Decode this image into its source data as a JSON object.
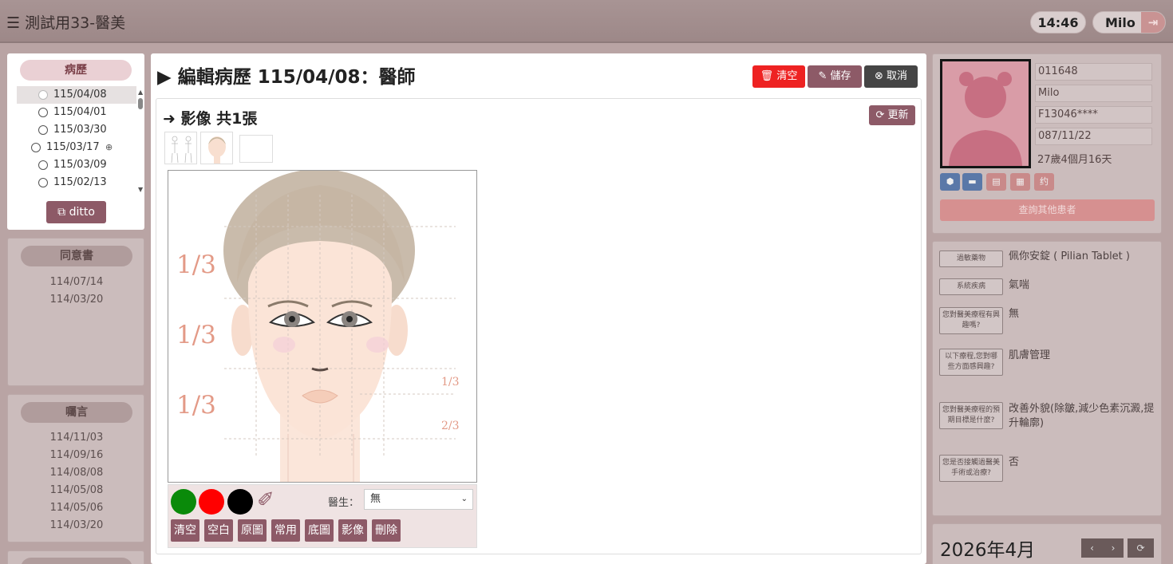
{
  "header": {
    "title": "測試用33-醫美",
    "time": "14:46",
    "user": "Milo"
  },
  "history": {
    "title": "病歷",
    "items": [
      {
        "date": "115/04/08",
        "selected": true
      },
      {
        "date": "115/04/01"
      },
      {
        "date": "115/03/30"
      },
      {
        "date": "115/03/17"
      },
      {
        "date": "115/03/09"
      },
      {
        "date": "115/02/13"
      }
    ],
    "ditto_label": "ditto"
  },
  "consent": {
    "title": "同意書",
    "dates": [
      "114/07/14",
      "114/03/20"
    ]
  },
  "instructions": {
    "title": "囑言",
    "dates": [
      "114/11/03",
      "114/09/16",
      "114/08/08",
      "114/05/08",
      "114/05/06",
      "114/03/20"
    ]
  },
  "editor": {
    "title": "編輯病歷 115/04/08：醫師",
    "clear_label": "清空",
    "save_label": "儲存",
    "cancel_label": "取消",
    "images_heading": "影像 共1張",
    "refresh_label": "更新",
    "face": {
      "third_1": "1/3",
      "third_2": "1/3",
      "third_3": "1/3",
      "small_1": "1/3",
      "small_2": "2/3"
    },
    "toolbox": {
      "colors": [
        "#0a8a0a",
        "#ff0000",
        "#000000"
      ],
      "doctor_label": "醫生：",
      "doctor_value": "無",
      "buttons": [
        "清空",
        "空白",
        "原圖",
        "常用",
        "底圖",
        "影像",
        "刪除"
      ]
    }
  },
  "patient": {
    "id": "011648",
    "name": "Milo",
    "national_id": "F13046****",
    "birthday": "087/11/22",
    "age": "27歲4個月16天",
    "search_label": "查詢其他患者"
  },
  "questions": [
    {
      "label": "過敏藥物",
      "answer": "佩你安錠 ( Pilian Tablet )"
    },
    {
      "label": "系統疾病",
      "answer": "氣喘"
    },
    {
      "label": "您對醫美療程有興趣嗎?",
      "answer": "無"
    },
    {
      "label": "以下療程,您對哪些方面感興趣?",
      "answer": "肌膚管理"
    },
    {
      "label": "您對醫美療程的預期目標是什麼?",
      "answer": "改善外貌(除皺,減少色素沉澱,提升輪廓)"
    },
    {
      "label": "您是否接觸過醫美手術或治療?",
      "answer": "否"
    }
  ],
  "calendar": {
    "title": "2026年4月"
  }
}
